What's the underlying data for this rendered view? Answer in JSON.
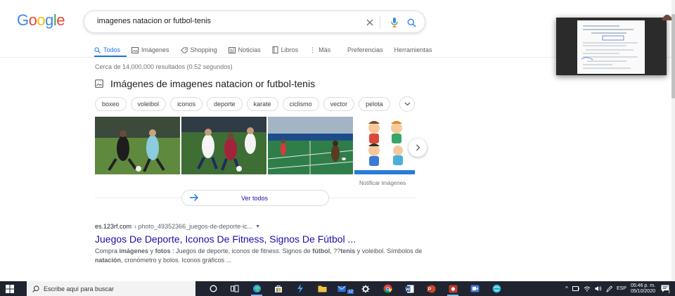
{
  "logo": {
    "letters": [
      "G",
      "o",
      "o",
      "g",
      "l",
      "e"
    ],
    "colors": [
      "#4285f4",
      "#ea4335",
      "#fbbc05",
      "#4285f4",
      "#34a853",
      "#ea4335"
    ]
  },
  "search": {
    "query": "imagenes natacion or futbol-tenis"
  },
  "tabs": [
    {
      "label": "Todos",
      "icon": "search-icon",
      "active": true
    },
    {
      "label": "Imágenes",
      "icon": "image-icon"
    },
    {
      "label": "Shopping",
      "icon": "tag-icon"
    },
    {
      "label": "Noticias",
      "icon": "news-icon"
    },
    {
      "label": "Libros",
      "icon": "book-icon"
    },
    {
      "label": "Más",
      "icon": "more-vert-icon"
    }
  ],
  "tools": {
    "preferences": "Preferencias",
    "tools": "Herramientas"
  },
  "stats": "Cerca de 14,000,000 resultados (0.52 segundos)",
  "images_section": {
    "title": "Imágenes de imagenes natacion or futbol-tenis",
    "chips": [
      "boxeo",
      "voleibol",
      "iconos",
      "deporte",
      "karate",
      "ciclismo",
      "vector",
      "pelota"
    ],
    "report": "Notificar imágenes",
    "see_all": "Ver todos"
  },
  "result": {
    "site": "es.123rf.com",
    "path": "› photo_49352366_juegos-de-deporte-ic...",
    "title": "Juegos De Deporte, Iconos De Fitness, Signos De Fútbol ...",
    "snippet_parts": [
      {
        "t": "Compra ",
        "b": false
      },
      {
        "t": "imágenes",
        "b": true
      },
      {
        "t": " y ",
        "b": false
      },
      {
        "t": "fotos",
        "b": true
      },
      {
        "t": " : Juegos de deporte, iconos de fitness. Signos de ",
        "b": false
      },
      {
        "t": "fútbol",
        "b": true
      },
      {
        "t": ", ??",
        "b": false
      },
      {
        "t": "tenis",
        "b": true
      },
      {
        "t": " y voleibol. Símbolos de ",
        "b": false
      },
      {
        "t": "natación",
        "b": true
      },
      {
        "t": ", cronómetro y bolos. Iconos gráficos ...",
        "b": false
      }
    ]
  },
  "taskbar": {
    "search_placeholder": "Escribe aquí para buscar",
    "tray_lang": "ESP",
    "clock_time": "05:46 p. m.",
    "clock_date": "05/10/2020",
    "mail_badge": "12",
    "notif_badge": "2"
  }
}
